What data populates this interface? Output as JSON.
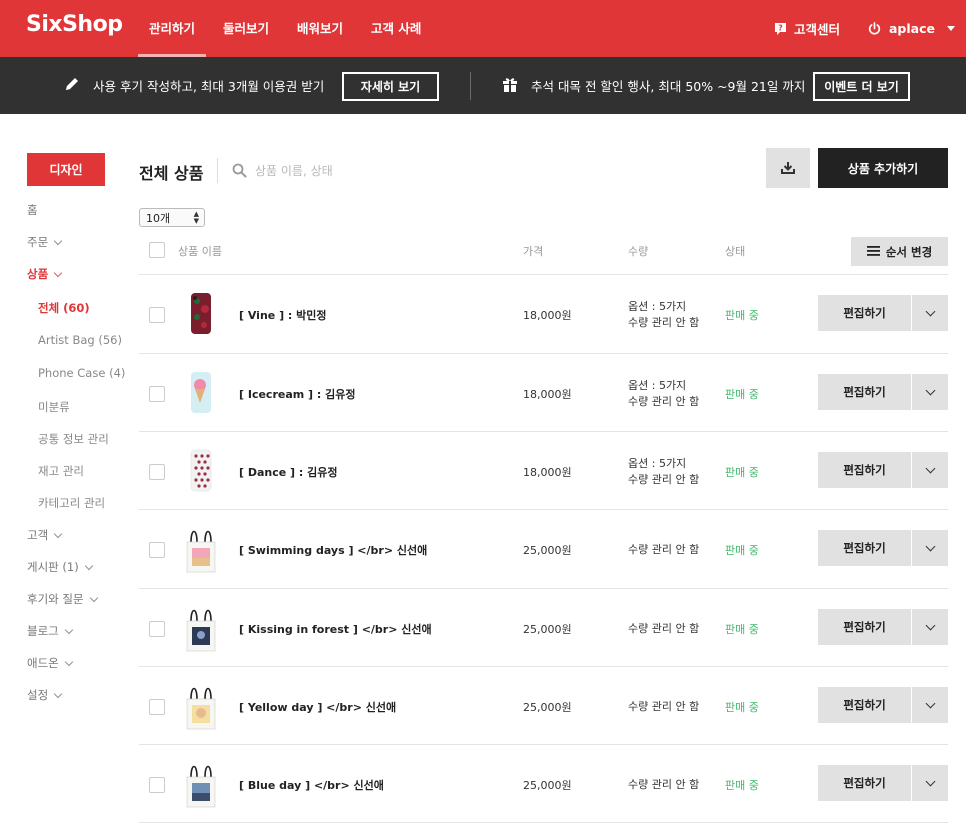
{
  "app": {
    "logo": "SixShop",
    "brand_color": "#e13638"
  },
  "topnav": {
    "items": [
      {
        "label": "관리하기",
        "active": true
      },
      {
        "label": "둘러보기"
      },
      {
        "label": "배워보기"
      },
      {
        "label": "고객 사례"
      }
    ],
    "help_label": "고객센터",
    "user_label": "aplace",
    "help_icon": "help-icon",
    "power_icon": "power-icon"
  },
  "promo": {
    "left_text": "사용 후기 작성하고, 최대 3개월 이용권 받기",
    "left_button": "자세히 보기",
    "right_text": "추석 대목 전 할인 행사, 최대 50% ~9월 21일 까지",
    "right_button": "이벤트 더 보기"
  },
  "sidebar": {
    "design_button": "디자인",
    "items": [
      {
        "label": "홈"
      },
      {
        "label": "주문"
      },
      {
        "label": "상품"
      },
      {
        "label": "전체 (60)"
      },
      {
        "label": "Artist Bag (56)"
      },
      {
        "label": "Phone Case (4)"
      },
      {
        "label": "미분류"
      },
      {
        "label": "공통 정보 관리"
      },
      {
        "label": "재고 관리"
      },
      {
        "label": "카테고리 관리"
      },
      {
        "label": "고객"
      },
      {
        "label": "게시판 (1)"
      },
      {
        "label": "후기와 질문"
      },
      {
        "label": "블로그"
      },
      {
        "label": "애드온"
      },
      {
        "label": "설정"
      }
    ]
  },
  "main": {
    "title": "전체 상품",
    "search_placeholder": "상품 이름, 상태",
    "add_button": "상품 추가하기",
    "per_page": "10개",
    "order_button": "순서 변경",
    "columns": {
      "name": "상품 이름",
      "price": "가격",
      "qty": "수량",
      "status": "상태"
    },
    "edit_label": "편집하기",
    "products": [
      {
        "name": "[ Vine ] : 박민정",
        "price": "18,000원",
        "qty_line1": "옵션 : 5가지",
        "qty_line2": "수량 관리 안 함",
        "status": "판매 중",
        "thumb": "phone-case-vine"
      },
      {
        "name": "[ Icecream ] : 김유정",
        "price": "18,000원",
        "qty_line1": "옵션 : 5가지",
        "qty_line2": "수량 관리 안 함",
        "status": "판매 중",
        "thumb": "phone-case-icecream"
      },
      {
        "name": "[ Dance ] : 김유정",
        "price": "18,000원",
        "qty_line1": "옵션 : 5가지",
        "qty_line2": "수량 관리 안 함",
        "status": "판매 중",
        "thumb": "phone-case-dance"
      },
      {
        "name": "[ Swimming days ] </br> 신선애",
        "price": "25,000원",
        "qty_line1": "수량 관리 안 함",
        "status": "판매 중",
        "thumb": "tote-bag-swimming"
      },
      {
        "name": "[ Kissing in forest ] </br> 신선애",
        "price": "25,000원",
        "qty_line1": "수량 관리 안 함",
        "status": "판매 중",
        "thumb": "tote-bag-kissing"
      },
      {
        "name": "[ Yellow day ] </br> 신선애",
        "price": "25,000원",
        "qty_line1": "수량 관리 안 함",
        "status": "판매 중",
        "thumb": "tote-bag-yellow"
      },
      {
        "name": "[ Blue day ] </br> 신선애",
        "price": "25,000원",
        "qty_line1": "수량 관리 안 함",
        "status": "판매 중",
        "thumb": "tote-bag-blue"
      }
    ],
    "status_color": "#3fb86b"
  }
}
